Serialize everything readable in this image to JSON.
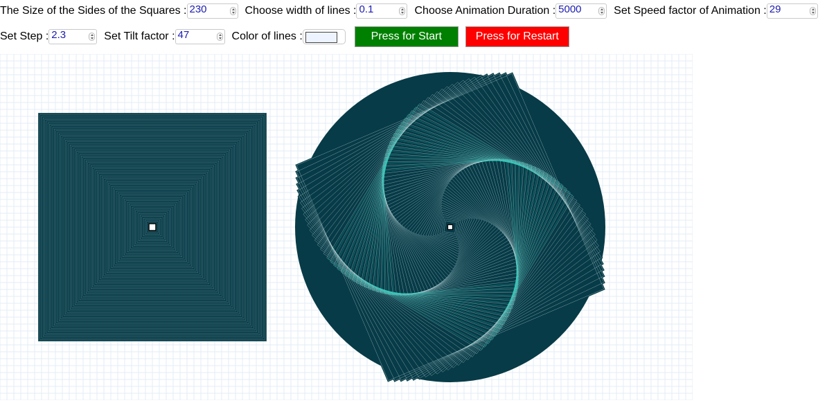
{
  "controls": {
    "side_size": {
      "label": "The Size of the Sides of the Squares :",
      "value": "230"
    },
    "line_width": {
      "label": "Choose width of lines :",
      "value": "0.1"
    },
    "duration": {
      "label": "Choose Animation Duration :",
      "value": "5000"
    },
    "speed": {
      "label": "Set Speed factor of Animation :",
      "value": "29"
    },
    "step": {
      "label": "Set Step :",
      "value": "2.3"
    },
    "tilt": {
      "label": "Set Tilt factor :",
      "value": "47"
    },
    "color": {
      "label": "Color of lines :",
      "value": "#eef4ff"
    },
    "start_label": "Press for Start",
    "restart_label": "Press for Restart"
  },
  "colors": {
    "fill": "#073b47",
    "line": "#d9f0f3",
    "accent": "#1fc7b5",
    "grid": "#e3ecf6",
    "start": "#008000",
    "restart": "#ff0000"
  }
}
